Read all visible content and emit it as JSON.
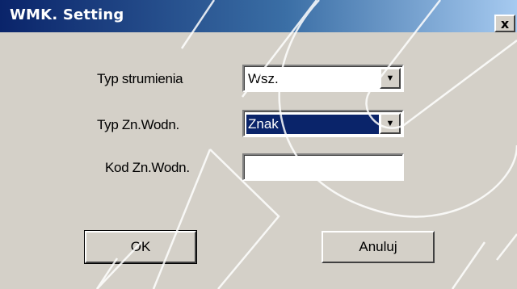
{
  "window": {
    "title": "WMK. Setting",
    "close_glyph": "x"
  },
  "form": {
    "stream_type_label": "Typ strumienia",
    "stream_type_value": "Wsz.",
    "watermark_type_label": "Typ Zn.Wodn.",
    "watermark_type_value": "Znak",
    "watermark_code_label": "Kod Zn.Wodn.",
    "watermark_code_value": ""
  },
  "buttons": {
    "ok_label": "OK",
    "cancel_label": "Anuluj"
  },
  "icons": {
    "close": "close-icon",
    "dropdown": "chevron-down-icon"
  },
  "colors": {
    "titlebar_start": "#0a246a",
    "titlebar_end": "#a6caf0",
    "dialog_bg": "#d4d0c8",
    "selection": "#0a246a"
  }
}
